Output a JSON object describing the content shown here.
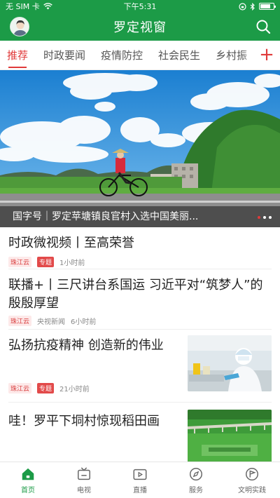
{
  "status_bar": {
    "carrier": "无 SIM 卡",
    "time": "下午5:31"
  },
  "header": {
    "title": "罗定视窗"
  },
  "tabs": [
    {
      "label": "推荐",
      "active": true
    },
    {
      "label": "时政要闻",
      "active": false
    },
    {
      "label": "疫情防控",
      "active": false
    },
    {
      "label": "社会民生",
      "active": false
    },
    {
      "label": "乡村振",
      "active": false
    }
  ],
  "tabs_add": "+",
  "banner": {
    "caption": "国字号｜罗定苹塘镇良官村入选中国美丽..."
  },
  "news": [
    {
      "title": "时政微视频丨至高荣誉",
      "source": "珠江云",
      "badge": "专题",
      "time": "1小时前"
    },
    {
      "title": "联播+丨三尺讲台系国运 习近平对“筑梦人”的殷殷厚望",
      "source": "珠江云",
      "publisher": "央视新闻",
      "time": "6小时前"
    },
    {
      "title": "弘扬抗疫精神 创造新的伟业",
      "source": "珠江云",
      "badge": "专题",
      "time": "21小时前"
    },
    {
      "title": "哇！罗平下垌村惊现稻田画"
    }
  ],
  "bottom_nav": [
    {
      "label": "首页",
      "icon": "home-icon",
      "active": true
    },
    {
      "label": "电视",
      "icon": "tv-icon",
      "active": false
    },
    {
      "label": "直播",
      "icon": "live-icon",
      "active": false
    },
    {
      "label": "服务",
      "icon": "compass-icon",
      "active": false
    },
    {
      "label": "文明实践",
      "icon": "flag-icon",
      "active": false
    }
  ],
  "colors": {
    "brand": "#1c9b47",
    "accent": "#e03a3a"
  }
}
